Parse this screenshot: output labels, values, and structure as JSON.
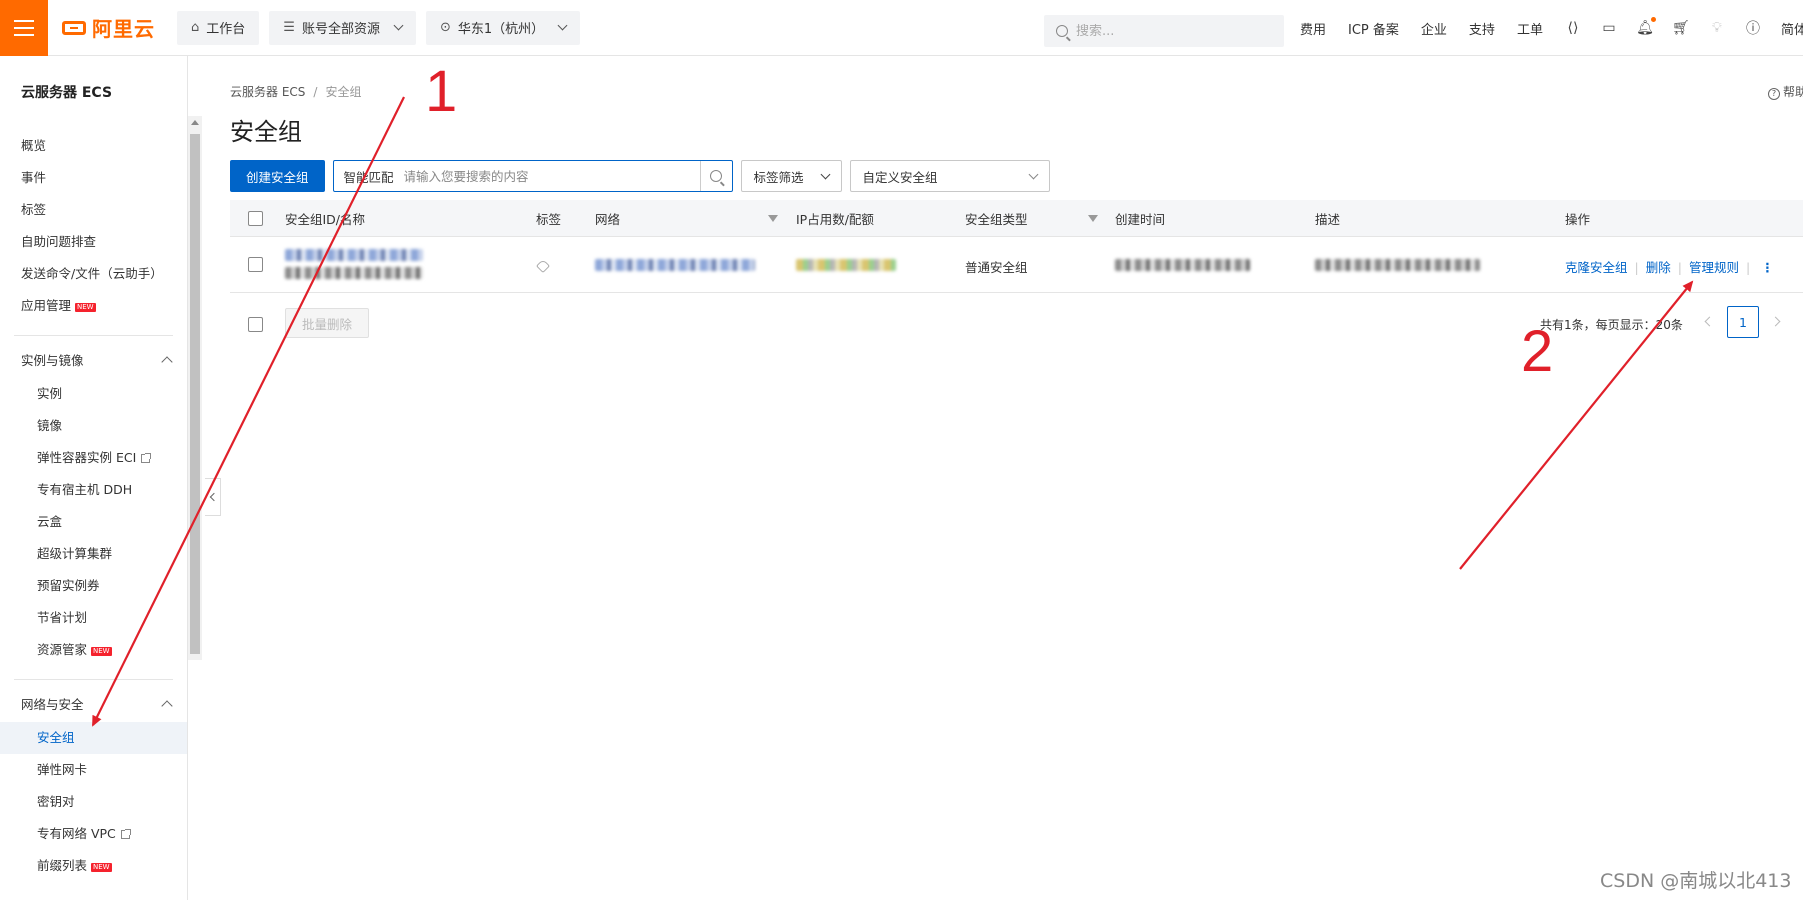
{
  "topbar": {
    "logo": "阿里云",
    "workbench": "工作台",
    "resources": "账号全部资源",
    "region": "华东1（杭州）",
    "search_placeholder": "搜索...",
    "links": [
      "费用",
      "ICP 备案",
      "企业",
      "支持",
      "工单"
    ],
    "right_icons": [
      "code-icon",
      "terminal-icon",
      "bell-icon",
      "cart-icon",
      "bulb-icon",
      "help-icon"
    ],
    "language": "简体"
  },
  "sidebar": {
    "title": "云服务器 ECS",
    "top_items": [
      "概览",
      "事件",
      "标签",
      "自助问题排查",
      "发送命令/文件（云助手）",
      "应用管理"
    ],
    "group1": {
      "label": "实例与镜像",
      "items": [
        "实例",
        "镜像",
        "弹性容器实例 ECI",
        "专有宿主机 DDH",
        "云盒",
        "超级计算集群",
        "预留实例券",
        "节省计划",
        "资源管家"
      ]
    },
    "group2": {
      "label": "网络与安全",
      "items": [
        "安全组",
        "弹性网卡",
        "密钥对",
        "专有网络 VPC",
        "前缀列表"
      ],
      "active": "安全组"
    },
    "new_badge": "NEW"
  },
  "main": {
    "breadcrumb": [
      "云服务器 ECS",
      "安全组"
    ],
    "help": "帮助",
    "title": "安全组",
    "create_button": "创建安全组",
    "smart_label": "智能匹配",
    "search_placeholder": "请输入您要搜索的内容",
    "tag_filter": "标签筛选",
    "custom_filter": "自定义安全组",
    "columns": [
      "安全组ID/名称",
      "标签",
      "网络",
      "IP占用数/配额",
      "安全组类型",
      "创建时间",
      "描述",
      "操作"
    ],
    "rows": [
      {
        "type": "普通安全组",
        "actions": [
          "克隆安全组",
          "删除",
          "管理规则"
        ]
      }
    ],
    "batch_delete": "批量删除",
    "pager_text": "共有1条，每页显示：20条",
    "current_page": "1"
  },
  "annotations": {
    "marker1": "1",
    "marker2": "2",
    "arrow_color": "#e0202a"
  },
  "watermark": "CSDN @南城以北413",
  "colors": {
    "brand": "#ff6a00",
    "primary": "#0064c8"
  }
}
